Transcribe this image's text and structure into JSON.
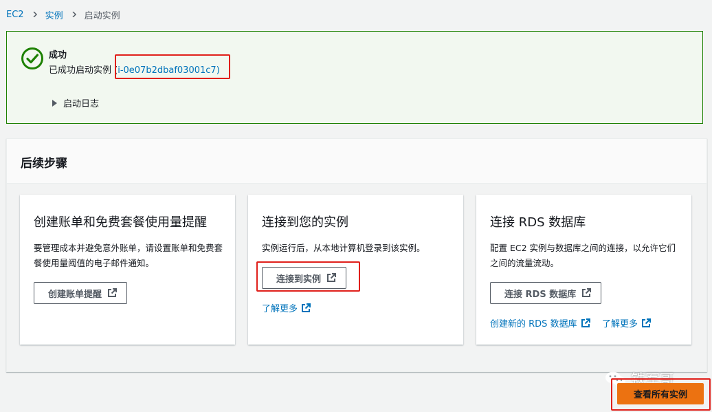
{
  "breadcrumb": {
    "items": [
      "EC2",
      "实例"
    ],
    "current": "启动实例"
  },
  "flash": {
    "title": "成功",
    "message_prefix": "已成功启动实例 (",
    "instance_id": "i-0e07b2dbaf03001c7",
    "message_suffix": ")",
    "log_label": "启动日志",
    "color_border": "#1d8102"
  },
  "next_steps": {
    "title": "后续步骤",
    "cards": [
      {
        "title": "创建账单和免费套餐使用量提醒",
        "description": "要管理成本并避免意外账单，请设置账单和免费套餐使用量阈值的电子邮件通知。",
        "button": "创建账单提醒"
      },
      {
        "title": "连接到您的实例",
        "description": "实例运行后，从本地计算机登录到该实例。",
        "button": "连接到实例",
        "link": "了解更多"
      },
      {
        "title": "连接 RDS 数据库",
        "description": "配置 EC2 实例与数据库之间的连接，以允许它们之间的流量流动。",
        "button": "连接 RDS 数据库",
        "link1": "创建新的 RDS 数据库",
        "link2": "了解更多"
      }
    ]
  },
  "primary_button": "查看所有实例",
  "watermark": "铁军哥",
  "colors": {
    "accent": "#ec7211",
    "link": "#0073bb",
    "highlight": "#e0201b"
  }
}
